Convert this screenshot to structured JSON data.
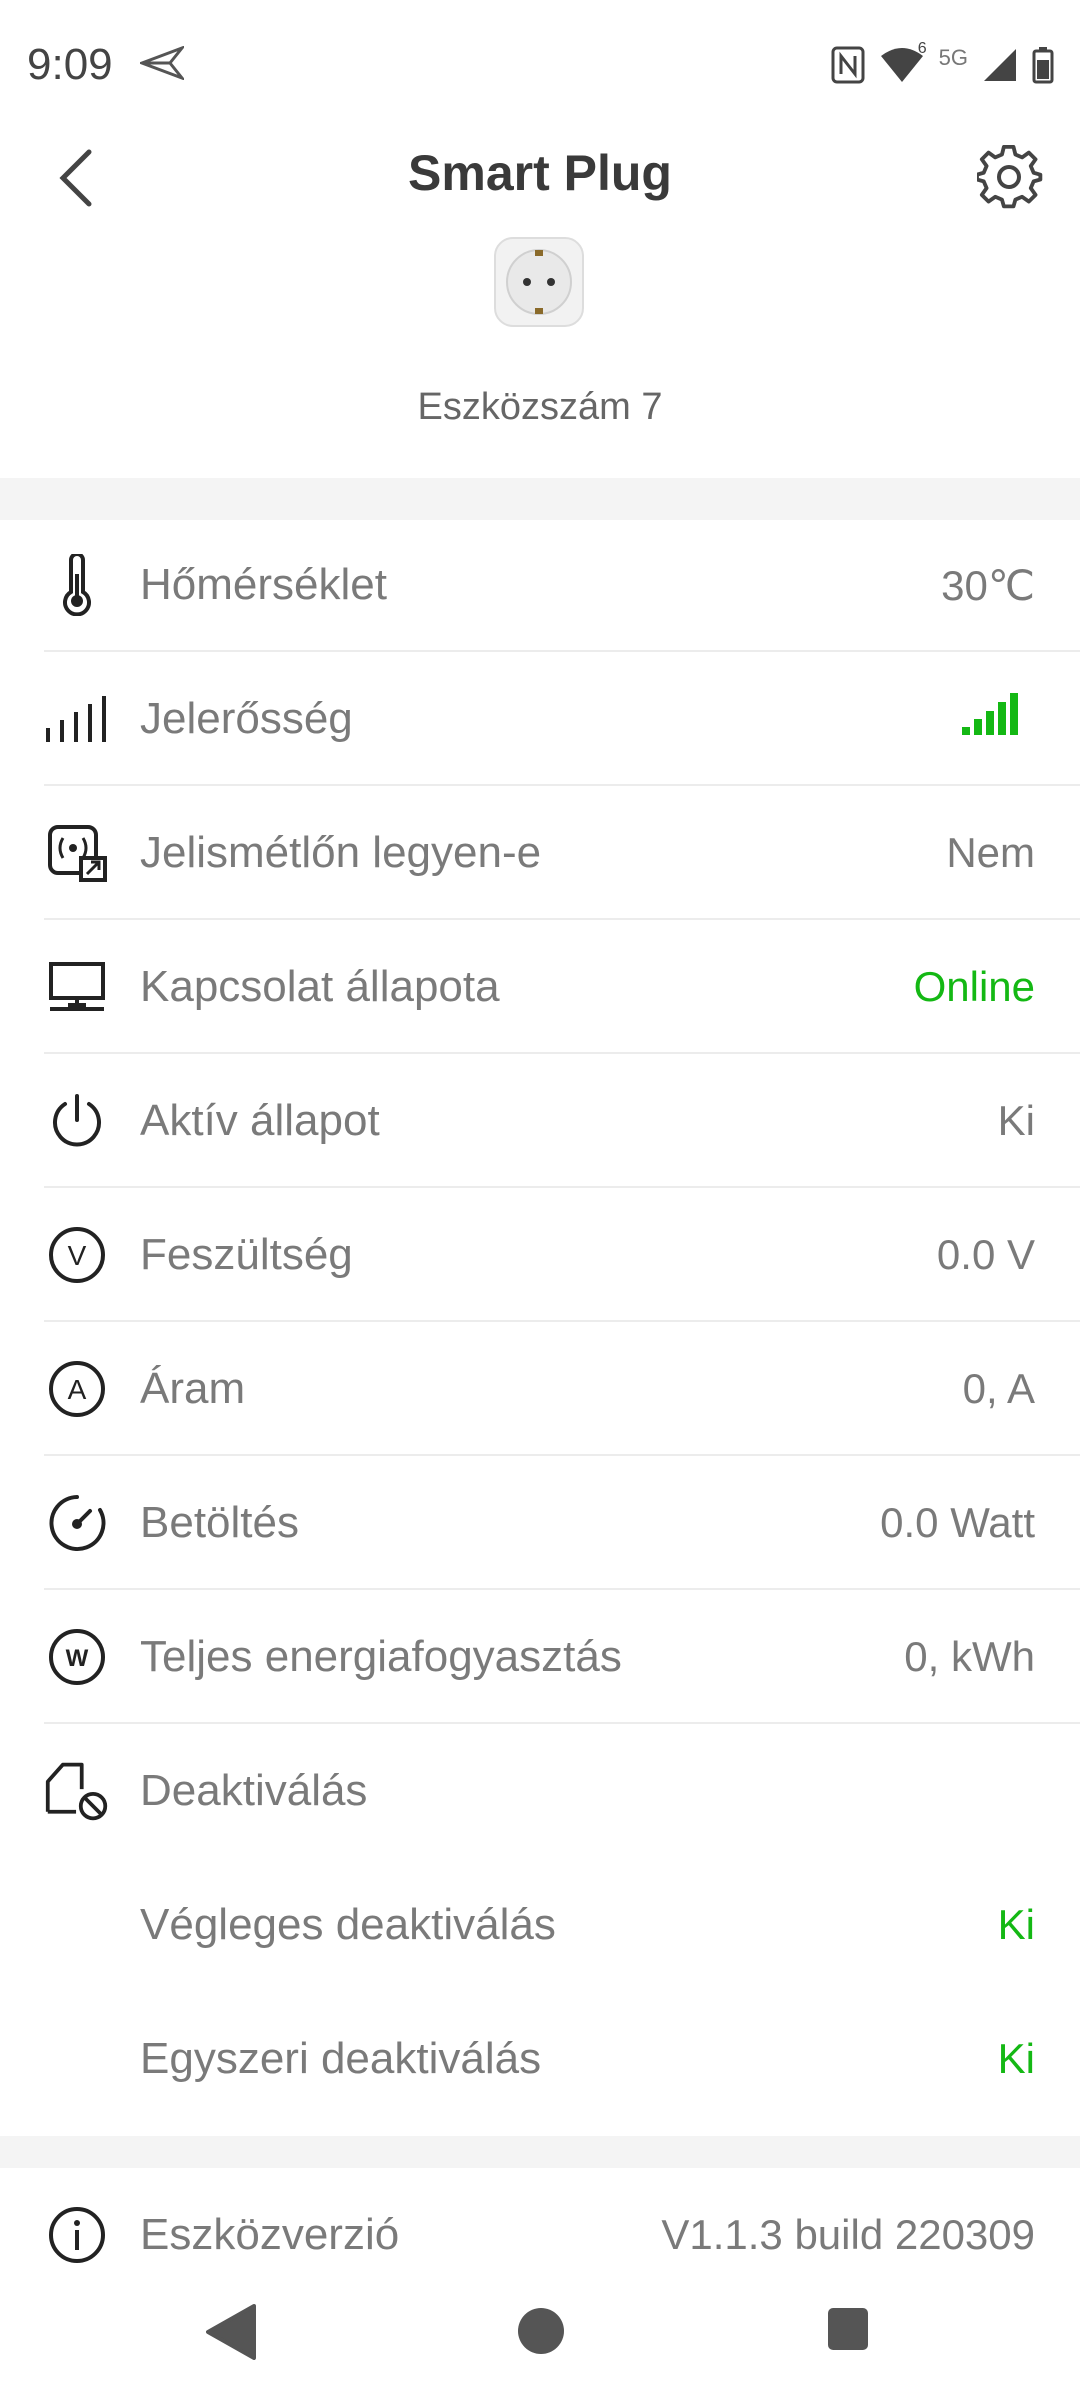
{
  "status": {
    "time": "9:09",
    "network_label": "5G",
    "wifi_badge": "6"
  },
  "header": {
    "title": "Smart Plug",
    "device_name": "Eszközszám 7"
  },
  "rows": [
    {
      "label": "Hőmérséklet",
      "value": "30℃",
      "icon": "thermometer-icon"
    },
    {
      "label": "Jelerősség",
      "value": "",
      "icon": "signal-bars-icon",
      "signal_level": "5 of 5"
    },
    {
      "label": "Jelismétlőn legyen-e",
      "value": "Nem",
      "icon": "repeater-icon"
    },
    {
      "label": "Kapcsolat állapota",
      "value": "Online",
      "icon": "monitor-icon"
    },
    {
      "label": "Aktív állapot",
      "value": "Ki",
      "icon": "power-icon"
    },
    {
      "label": "Feszültség",
      "value": "0.0 V",
      "icon": "voltage-icon"
    },
    {
      "label": "Áram",
      "value": "0, A",
      "icon": "current-icon"
    },
    {
      "label": "Betöltés",
      "value": "0.0 Watt",
      "icon": "gauge-icon"
    },
    {
      "label": "Teljes energiafogyasztás",
      "value": "0, kWh",
      "icon": "watt-icon"
    }
  ],
  "deactivation": {
    "label": "Deaktiválás",
    "permanent_label": "Végleges deaktiválás",
    "permanent_value": "Ki",
    "single_label": "Egyszeri deaktiválás",
    "single_value": "Ki"
  },
  "version": {
    "label": "Eszközverzió",
    "value": "V1.1.3 build 220309"
  },
  "colors": {
    "accent_green": "#14b814",
    "text_gray": "#7a7a7a"
  }
}
